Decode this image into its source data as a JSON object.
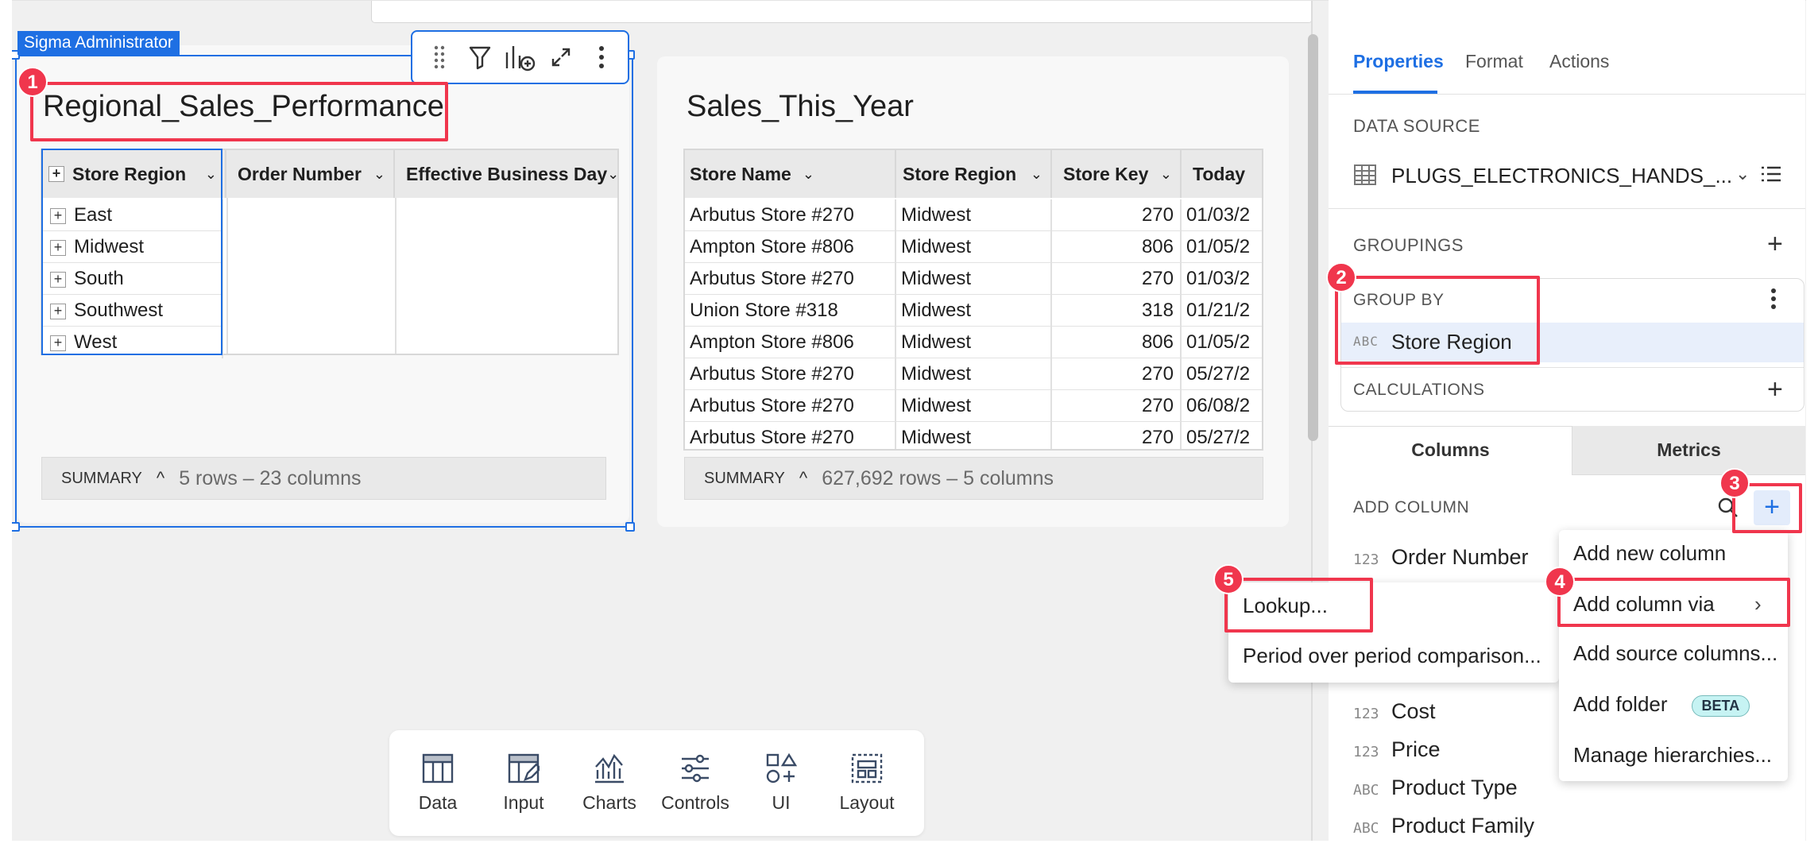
{
  "canvas": {
    "admin_badge": "Sigma Administrator"
  },
  "left_table": {
    "title": "Regional_Sales_Performance",
    "headers": [
      "Store Region",
      "Order Number",
      "Effective Business Day"
    ],
    "rows": [
      "East",
      "Midwest",
      "South",
      "Southwest",
      "West"
    ],
    "summary_label": "SUMMARY",
    "summary_rows": "5 rows – 23 columns"
  },
  "right_table": {
    "title": "Sales_This_Year",
    "headers": [
      "Store Name",
      "Store Region",
      "Store Key",
      "Today"
    ],
    "rows": [
      [
        "Arbutus Store #270",
        "Midwest",
        "270",
        "01/03/2"
      ],
      [
        "Ampton Store #806",
        "Midwest",
        "806",
        "01/05/2"
      ],
      [
        "Arbutus Store #270",
        "Midwest",
        "270",
        "01/03/2"
      ],
      [
        "Union Store #318",
        "Midwest",
        "318",
        "01/21/2"
      ],
      [
        "Ampton Store #806",
        "Midwest",
        "806",
        "01/05/2"
      ],
      [
        "Arbutus Store #270",
        "Midwest",
        "270",
        "05/27/2"
      ],
      [
        "Arbutus Store #270",
        "Midwest",
        "270",
        "06/08/2"
      ],
      [
        "Arbutus Store #270",
        "Midwest",
        "270",
        "05/27/2"
      ]
    ],
    "summary_label": "SUMMARY",
    "summary_rows": "627,692 rows – 5 columns"
  },
  "bottom_toolbar": {
    "items": [
      {
        "label": "Data",
        "icon": "table-icon"
      },
      {
        "label": "Input",
        "icon": "input-table-icon"
      },
      {
        "label": "Charts",
        "icon": "charts-icon"
      },
      {
        "label": "Controls",
        "icon": "sliders-icon"
      },
      {
        "label": "UI",
        "icon": "ui-elements-icon"
      },
      {
        "label": "Layout",
        "icon": "layout-icon"
      }
    ]
  },
  "panel": {
    "tabs": [
      "Properties",
      "Format",
      "Actions"
    ],
    "data_source_label": "DATA SOURCE",
    "data_source_name": "PLUGS_ELECTRONICS_HANDS_...",
    "groupings_label": "GROUPINGS",
    "group_by_label": "GROUP BY",
    "group_by_type": "ABC",
    "group_by_value": "Store Region",
    "calculations_label": "CALCULATIONS",
    "subtabs": [
      "Columns",
      "Metrics"
    ],
    "add_column_label": "ADD COLUMN",
    "columns": [
      {
        "type": "123",
        "name": "Order Number"
      },
      {
        "type": "123",
        "name": "Cost"
      },
      {
        "type": "123",
        "name": "Price"
      },
      {
        "type": "ABC",
        "name": "Product Type"
      },
      {
        "type": "ABC",
        "name": "Product Family"
      }
    ]
  },
  "add_menu": {
    "items": [
      "Add new column",
      "Add column via",
      "Add source columns...",
      "Add folder",
      "Manage hierarchies..."
    ],
    "beta": "BETA"
  },
  "sub_menu": {
    "items": [
      "Lookup...",
      "Period over period comparison..."
    ]
  },
  "annotations": [
    "1",
    "2",
    "3",
    "4",
    "5"
  ],
  "colors": {
    "accent": "#1e6fe3",
    "highlight": "#f0364d"
  }
}
